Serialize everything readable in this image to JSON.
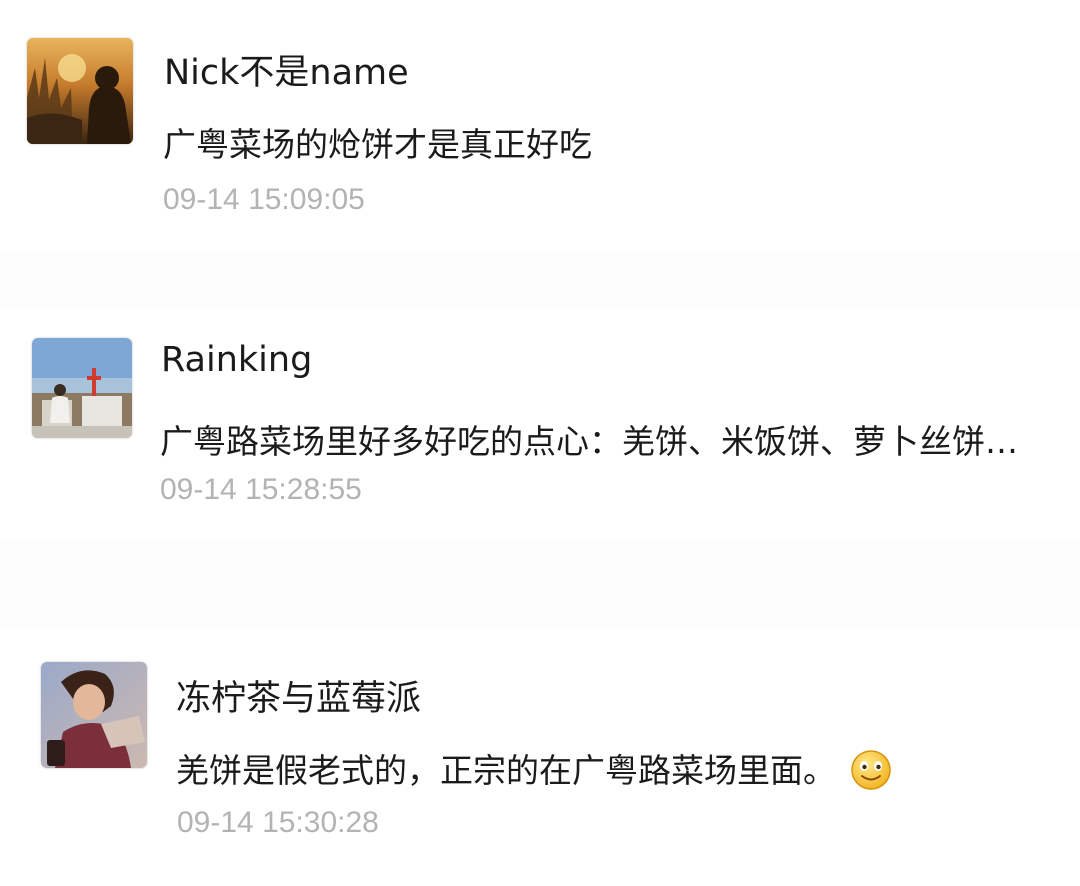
{
  "comments": [
    {
      "user": "Nick不是name",
      "text": "广粤菜场的炝饼才是真正好吃",
      "time": "09-14 15:09:05",
      "avatar": "sunset-field-avatar"
    },
    {
      "user": "Rainking",
      "text": "广粤路菜场里好多好吃的点心：羌饼、米饭饼、萝卜丝饼…",
      "time": "09-14 15:28:55",
      "avatar": "coastal-church-avatar"
    },
    {
      "user": "冻柠茶与蓝莓派",
      "text": "羌饼是假老式的，正宗的在广粤路菜场里面。",
      "time": "09-14 15:30:28",
      "avatar": "woman-portrait-avatar",
      "emoji": "smile-emoji"
    }
  ],
  "colors": {
    "timestamp": "#b3b3b3",
    "text": "#1b1b1b",
    "background": "#ffffff"
  }
}
